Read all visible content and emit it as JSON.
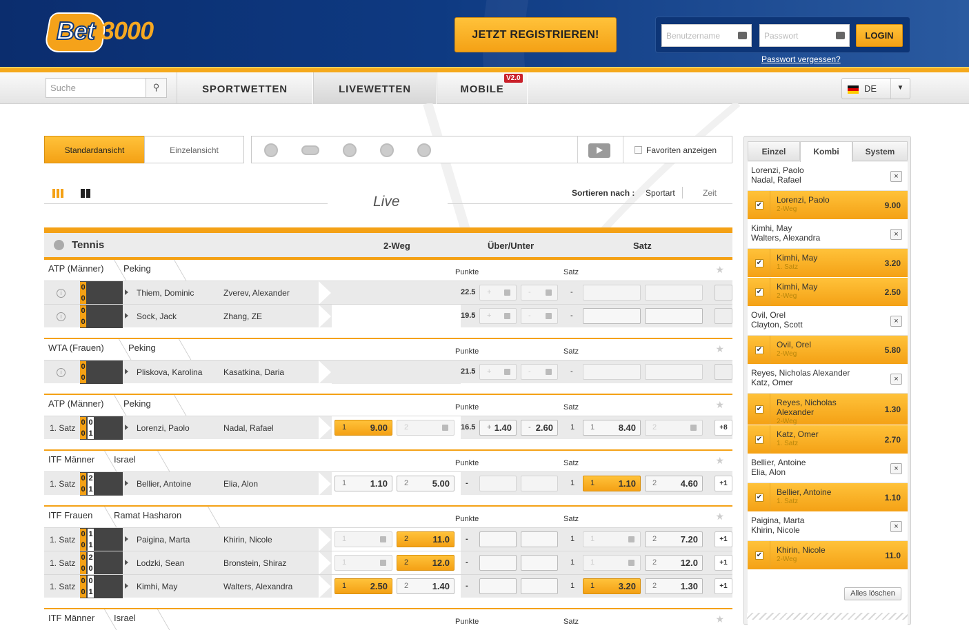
{
  "header": {
    "logo_left": "Bet",
    "logo_right": "3000",
    "register": "JETZT REGISTRIEREN!",
    "user_placeholder": "Benutzername",
    "pass_placeholder": "Passwort",
    "login": "LOGIN",
    "forgot": "Passwort vergessen?"
  },
  "nav": {
    "search_placeholder": "Suche",
    "items": [
      "SPORTWETTEN",
      "LIVEWETTEN",
      "MOBILE"
    ],
    "badge": "V2.0",
    "lang": "DE"
  },
  "view": {
    "standard": "Standardansicht",
    "single": "Einzelansicht",
    "favorites": "Favoriten anzeigen"
  },
  "live": {
    "title": "Live",
    "sort_label": "Sortieren nach :",
    "sort_a": "Sportart",
    "sort_b": "Zeit"
  },
  "tennis": {
    "title": "Tennis",
    "col1": "2-Weg",
    "col2": "Über/Unter",
    "col3": "Satz"
  },
  "labels": {
    "punkte": "Punkte",
    "satz": "Satz",
    "dash": "-",
    "star": "★",
    "info": "i"
  },
  "sections": [
    {
      "cat": "ATP (Männer)",
      "loc": "Peking",
      "rows": [
        {
          "period": "",
          "s1": "0",
          "s2": "0",
          "g1": "",
          "g2": "",
          "p1": "Thiem, Dominic",
          "p2": "Zverev, Alexander",
          "pk": "22.5",
          "kind": "locked",
          "satz": "-"
        },
        {
          "period": "",
          "s1": "0",
          "s2": "0",
          "g1": "",
          "g2": "",
          "p1": "Sock, Jack",
          "p2": "Zhang, ZE",
          "pk": "19.5",
          "kind": "locked2",
          "satz": "-"
        }
      ]
    },
    {
      "cat": "WTA (Frauen)",
      "loc": "Peking",
      "rows": [
        {
          "period": "",
          "s1": "0",
          "s2": "0",
          "g1": "",
          "g2": "",
          "p1": "Pliskova, Karolina",
          "p2": "Kasatkina, Daria",
          "pk": "21.5",
          "kind": "locked",
          "satz": "-"
        }
      ]
    },
    {
      "cat": "ATP (Männer)",
      "loc": "Peking",
      "rows": [
        {
          "period": "1. Satz",
          "s1": "0",
          "s2": "0",
          "g1": "0",
          "g2": "1",
          "p1": "Lorenzi, Paolo",
          "p2": "Nadal, Rafael",
          "pk": "16.5",
          "o1": "9.00",
          "o2": "",
          "ou1": "1.40",
          "ou2": "2.60",
          "satz": "1",
          "st1": "8.40",
          "st2": "",
          "more": "+8",
          "kind": "full"
        }
      ]
    },
    {
      "cat": "ITF Männer",
      "loc": "Israel",
      "rows": [
        {
          "period": "1. Satz",
          "s1": "0",
          "s2": "0",
          "g1": "2",
          "g2": "1",
          "p1": "Bellier, Antoine",
          "p2": "Elia, Alon",
          "pk": "",
          "o1": "1.10",
          "o2": "5.00",
          "satz": "1",
          "st1": "1.10",
          "st2": "4.60",
          "more": "+1",
          "kind": "itf"
        }
      ]
    },
    {
      "cat": "ITF Frauen",
      "loc": "Ramat Hasharon",
      "rows": [
        {
          "period": "1. Satz",
          "s1": "0",
          "s2": "0",
          "g1": "1",
          "g2": "1",
          "p1": "Paigina, Marta",
          "p2": "Khirin, Nicole",
          "o1": "",
          "o2": "11.0",
          "satz": "1",
          "st1": "",
          "st2": "7.20",
          "more": "+1",
          "kind": "itf2"
        },
        {
          "period": "1. Satz",
          "s1": "0",
          "s2": "0",
          "g1": "2",
          "g2": "0",
          "p1": "Lodzki, Sean",
          "p2": "Bronstein, Shiraz",
          "o1": "",
          "o2": "12.0",
          "satz": "1",
          "st1": "",
          "st2": "12.0",
          "more": "+1",
          "kind": "itf2"
        },
        {
          "period": "1. Satz",
          "s1": "0",
          "s2": "0",
          "g1": "0",
          "g2": "1",
          "p1": "Kimhi, May",
          "p2": "Walters, Alexandra",
          "o1": "2.50",
          "o2": "1.40",
          "satz": "1",
          "st1": "3.20",
          "st2": "1.30",
          "more": "+1",
          "kind": "itf3"
        }
      ]
    },
    {
      "cat": "ITF Männer",
      "loc": "Israel",
      "rows": []
    }
  ],
  "slip": {
    "tabs": [
      "Einzel",
      "Kombi",
      "System"
    ],
    "clear": "Alles löschen",
    "matches": [
      {
        "h1": "Lorenzi, Paolo",
        "h2": "Nadal, Rafael",
        "sels": [
          {
            "n": "Lorenzi, Paolo",
            "m": "2-Weg",
            "o": "9.00"
          }
        ]
      },
      {
        "h1": "Kimhi, May",
        "h2": "Walters, Alexandra",
        "sels": [
          {
            "n": "Kimhi, May",
            "m": "1. Satz",
            "o": "3.20"
          },
          {
            "n": "Kimhi, May",
            "m": "2-Weg",
            "o": "2.50"
          }
        ]
      },
      {
        "h1": "Ovil, Orel",
        "h2": "Clayton, Scott",
        "sels": [
          {
            "n": "Ovil, Orel",
            "m": "2-Weg",
            "o": "5.80"
          }
        ]
      },
      {
        "h1": "Reyes, Nicholas Alexander",
        "h2": "Katz, Omer",
        "sels": [
          {
            "n": "Reyes, Nicholas Alexander",
            "m": "2-Weg",
            "o": "1.30"
          },
          {
            "n": "Katz, Omer",
            "m": "1. Satz",
            "o": "2.70"
          }
        ]
      },
      {
        "h1": "Bellier, Antoine",
        "h2": "Elia, Alon",
        "sels": [
          {
            "n": "Bellier, Antoine",
            "m": "1. Satz",
            "o": "1.10"
          }
        ]
      },
      {
        "h1": "Paigina, Marta",
        "h2": "Khirin, Nicole",
        "sels": [
          {
            "n": "Khirin, Nicole",
            "m": "2-Weg",
            "o": "11.0"
          }
        ]
      }
    ]
  }
}
